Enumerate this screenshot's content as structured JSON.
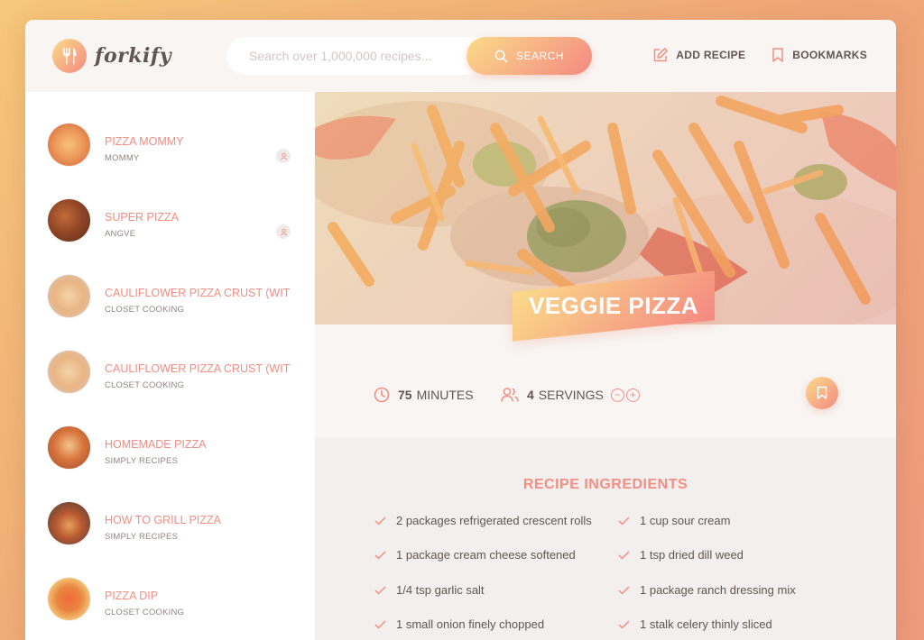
{
  "header": {
    "logo_text": "forkify",
    "search_placeholder": "Search over 1,000,000 recipes...",
    "search_button": "SEARCH",
    "add_recipe": "ADD RECIPE",
    "bookmarks": "BOOKMARKS"
  },
  "results": [
    {
      "title": "PIZZA MOMMY",
      "publisher": "MOMMY",
      "user": true
    },
    {
      "title": "SUPER PIZZA",
      "publisher": "ANGVE",
      "user": true
    },
    {
      "title": "CAULIFLOWER PIZZA CRUST (WIT...",
      "publisher": "CLOSET COOKING",
      "user": false
    },
    {
      "title": "CAULIFLOWER PIZZA CRUST (WIT...",
      "publisher": "CLOSET COOKING",
      "user": false
    },
    {
      "title": "HOMEMADE PIZZA",
      "publisher": "SIMPLY RECIPES",
      "user": false
    },
    {
      "title": "HOW TO GRILL PIZZA",
      "publisher": "SIMPLY RECIPES",
      "user": false
    },
    {
      "title": "PIZZA DIP",
      "publisher": "CLOSET COOKING",
      "user": false
    }
  ],
  "recipe": {
    "title": "VEGGIE PIZZA",
    "minutes_value": "75",
    "minutes_unit": "MINUTES",
    "servings_value": "4",
    "servings_unit": "SERVINGS",
    "ingredients_heading": "RECIPE INGREDIENTS",
    "ingredients": [
      "2 packages refrigerated crescent rolls",
      "1 cup sour cream",
      "1 package cream cheese softened",
      "1 tsp dried dill weed",
      "1/4 tsp garlic salt",
      "1 package ranch dressing mix",
      "1 small onion finely chopped",
      "1 stalk celery thinly sliced"
    ]
  },
  "colors": {
    "accent": "#f38e82",
    "gradient_start": "#fbdb89",
    "gradient_end": "#f48982",
    "text": "#615551"
  }
}
